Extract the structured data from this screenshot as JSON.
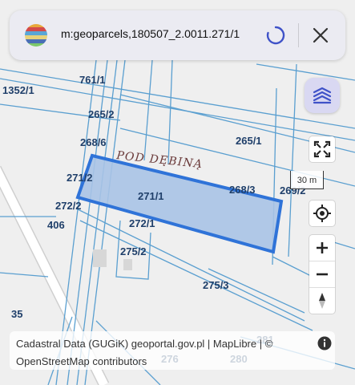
{
  "search": {
    "query": "m:geoparcels,180507_2.0011.271/1"
  },
  "map": {
    "place_name": "POD DĘBINĄ",
    "parcel_labels": [
      "1352/1",
      "761/1",
      "265/2",
      "268/6",
      "265/1",
      "271/2",
      "271/1",
      "268/3",
      "269/2",
      "272/2",
      "406",
      "272/1",
      "275/2",
      "275/3",
      "35",
      "281",
      "276",
      "280"
    ],
    "selected_parcel": "271/1",
    "colors": {
      "background": "#efefef",
      "parcel_line": "#5a9fd0",
      "selected_fill": "#a9c3e6",
      "selected_stroke": "#2f73d8"
    }
  },
  "controls": {
    "layers_icon": "layers-icon",
    "fullscreen_icon": "fullscreen-icon",
    "scale_label": "30 m",
    "locate_icon": "locate-icon",
    "zoom_in_label": "+",
    "zoom_out_label": "−",
    "compass_icon": "compass-icon"
  },
  "attribution": {
    "line1": "Cadastral Data (GUGiK) geoportal.gov.pl | MapLibre | ©",
    "line2": "OpenStreetMap contributors"
  }
}
